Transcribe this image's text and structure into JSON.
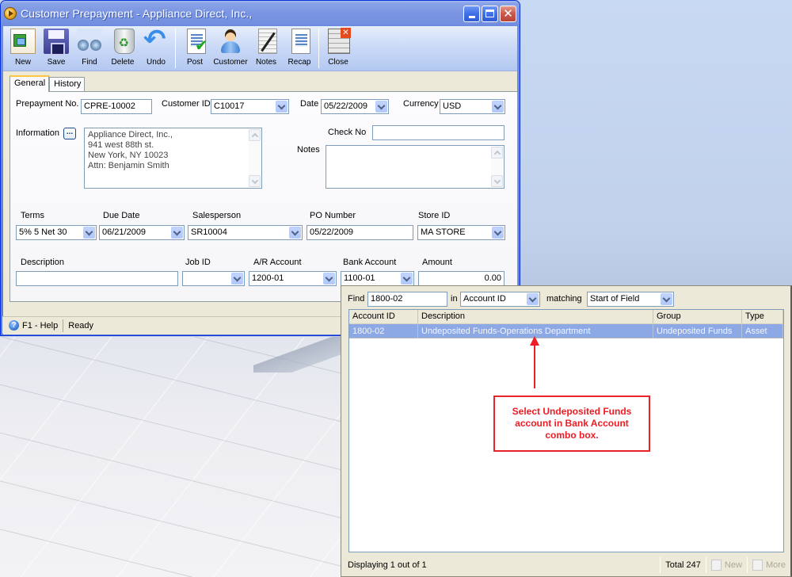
{
  "window": {
    "title": "Customer Prepayment - Appliance Direct, Inc.,",
    "controls": {
      "minimize": "minimize",
      "maximize": "maximize",
      "close": "close"
    }
  },
  "toolbar": {
    "items": [
      {
        "label": "New",
        "icon": "new-document-icon"
      },
      {
        "label": "Save",
        "icon": "floppy-disk-icon"
      },
      {
        "label": "Find",
        "icon": "binoculars-icon"
      },
      {
        "label": "Delete",
        "icon": "recycle-bin-icon"
      },
      {
        "label": "Undo",
        "icon": "undo-arrow-icon"
      },
      {
        "label": "Post",
        "icon": "post-check-icon"
      },
      {
        "label": "Customer",
        "icon": "customer-person-icon"
      },
      {
        "label": "Notes",
        "icon": "notepad-pen-icon"
      },
      {
        "label": "Recap",
        "icon": "recap-sheet-icon"
      },
      {
        "label": "Close",
        "icon": "close-window-icon"
      }
    ]
  },
  "tabs": [
    {
      "label": "General",
      "active": true
    },
    {
      "label": "History",
      "active": false
    }
  ],
  "form": {
    "prepayment_no": {
      "label": "Prepayment No.",
      "value": "CPRE-10002"
    },
    "customer_id": {
      "label": "Customer ID",
      "value": "C10017"
    },
    "date": {
      "label": "Date",
      "value": "05/22/2009"
    },
    "currency": {
      "label": "Currency",
      "value": "USD"
    },
    "information": {
      "label": "Information",
      "button": "...",
      "lines": [
        "Appliance Direct, Inc.,",
        "941 west 88th st.",
        "New York, NY 10023",
        "Attn: Benjamin Smith"
      ]
    },
    "check_no": {
      "label": "Check No",
      "value": ""
    },
    "notes": {
      "label": "Notes",
      "value": ""
    },
    "terms": {
      "label": "Terms",
      "value": "5% 5 Net 30"
    },
    "due_date": {
      "label": "Due Date",
      "value": "06/21/2009"
    },
    "salesperson": {
      "label": "Salesperson",
      "value": "SR10004"
    },
    "po_number": {
      "label": "PO Number",
      "value": "05/22/2009"
    },
    "store_id": {
      "label": "Store ID",
      "value": "MA STORE"
    },
    "description": {
      "label": "Description",
      "value": ""
    },
    "job_id": {
      "label": "Job ID",
      "value": ""
    },
    "ar_account": {
      "label": "A/R Account",
      "value": "1200-01"
    },
    "bank_account": {
      "label": "Bank Account",
      "value": "1100-01"
    },
    "amount": {
      "label": "Amount",
      "value": "0.00"
    }
  },
  "statusbar": {
    "help": "F1 - Help",
    "status": "Ready"
  },
  "lookup": {
    "find_label": "Find",
    "find_value": "1800-02",
    "in_label": "in",
    "in_value": "Account ID",
    "matching_label": "matching",
    "matching_value": "Start of Field",
    "columns": [
      "Account ID",
      "Description",
      "Group",
      "Type"
    ],
    "rows": [
      [
        "1800-02",
        "Undeposited Funds-Operations Department",
        "Undeposited Funds",
        "Asset"
      ]
    ],
    "status": {
      "displaying": "Displaying 1 out of 1",
      "total": "Total 247",
      "new": "New",
      "more": "More"
    }
  },
  "annotation": {
    "text": "Select Undeposited Funds account in Bank Account combo box.",
    "color": "#ee1c24"
  },
  "colors": {
    "titlebar": "#7a95e2",
    "selected_row": "#8ca9e6",
    "window_face": "#ece9d8",
    "input_border": "#7f9db9"
  }
}
